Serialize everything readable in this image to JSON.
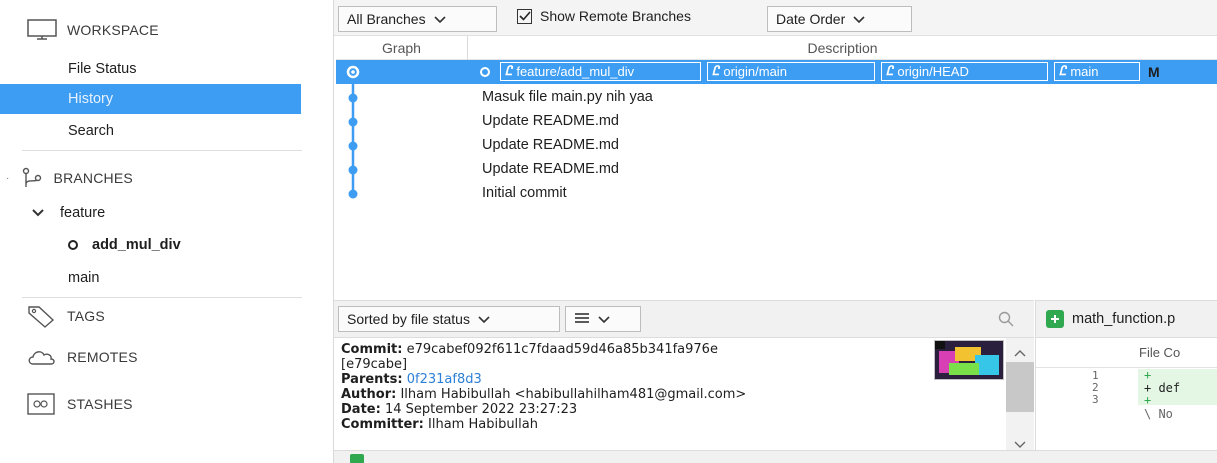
{
  "sidebar": {
    "workspace": {
      "label": "WORKSPACE",
      "icon": "monitor-icon"
    },
    "workspace_items": [
      {
        "label": "File Status",
        "selected": false
      },
      {
        "label": "History",
        "selected": true
      },
      {
        "label": "Search",
        "selected": false
      }
    ],
    "branches": {
      "label": "BRANCHES",
      "icon": "branch-icon"
    },
    "branch_group": {
      "label": "feature",
      "expanded": true
    },
    "branch_items": [
      {
        "label": "add_mul_div",
        "current": true
      },
      {
        "label": "main",
        "current": false
      }
    ],
    "tags": {
      "label": "TAGS",
      "icon": "tag-icon"
    },
    "remotes": {
      "label": "REMOTES",
      "icon": "cloud-icon"
    },
    "stashes": {
      "label": "STASHES",
      "icon": "stash-icon"
    }
  },
  "toolbar": {
    "branches_filter": "All Branches",
    "show_remote_label": "Show Remote Branches",
    "show_remote_checked": true,
    "order": "Date Order"
  },
  "commit_list": {
    "columns": {
      "graph": "Graph",
      "description": "Description"
    },
    "refs": [
      "feature/add_mul_div",
      "origin/main",
      "origin/HEAD",
      "main"
    ],
    "selected_message_fragment": "M",
    "commits": [
      "Masuk file main.py nih yaa",
      "Update README.md",
      "Update README.md",
      "Update README.md",
      "Initial commit"
    ]
  },
  "files_toolbar": {
    "sort": "Sorted by file status"
  },
  "commit_details": {
    "commit_label": "Commit:",
    "commit_hash": "e79cabef092f611c7fdaad59d46a85b341fa976e",
    "short_hash": "[e79cabe]",
    "parents_label": "Parents:",
    "parents": "0f231af8d3",
    "author_label": "Author:",
    "author": "Ilham Habibullah <habibullahilham481@gmail.com>",
    "date_label": "Date:",
    "date": "14 September 2022 23:27:23",
    "committer_label": "Committer:",
    "committer": "Ilham Habibullah"
  },
  "diff": {
    "file_name": "math_function.p",
    "column_header": "File Co",
    "line_numbers": [
      "1",
      "2",
      "3"
    ],
    "lines": [
      "+",
      "+ def",
      "+",
      "\\ No"
    ]
  },
  "colors": {
    "selection": "#3d9df3",
    "graph": "#3d9df3",
    "link": "#2c7fd7",
    "add_file": "#2fa84f"
  }
}
